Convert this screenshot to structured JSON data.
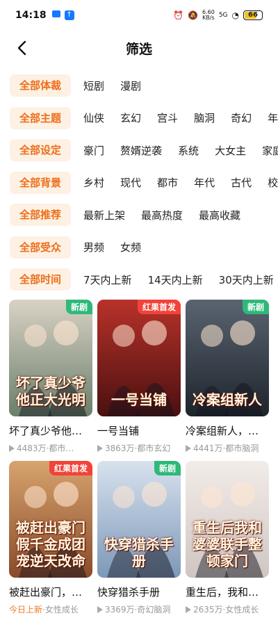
{
  "status": {
    "time": "14:18",
    "net_speed_top": "6.60",
    "net_speed_bottom": "KB/s",
    "signal": "5G",
    "battery": "66"
  },
  "header": {
    "title": "筛选"
  },
  "filters": [
    {
      "selected": "全部体裁",
      "options": [
        "短剧",
        "漫剧"
      ]
    },
    {
      "selected": "全部主题",
      "options": [
        "仙侠",
        "玄幻",
        "宫斗",
        "脑洞",
        "奇幻",
        "年代"
      ]
    },
    {
      "selected": "全部设定",
      "options": [
        "豪门",
        "赘婿逆袭",
        "系统",
        "大女主",
        "家庭"
      ]
    },
    {
      "selected": "全部背景",
      "options": [
        "乡村",
        "现代",
        "都市",
        "年代",
        "古代",
        "校园"
      ]
    },
    {
      "selected": "全部推荐",
      "options": [
        "最新上架",
        "最高热度",
        "最高收藏"
      ]
    },
    {
      "selected": "全部受众",
      "options": [
        "男频",
        "女频"
      ]
    },
    {
      "selected": "全部时间",
      "options": [
        "7天内上新",
        "14天内上新",
        "30天内上新"
      ]
    }
  ],
  "cards": [
    {
      "title": "坏了真少爷他…",
      "poster_text": "坏了真少爷他正大光明",
      "badge": "新剧",
      "badge_color": "#2fb87a",
      "views": "4483万",
      "tags": "都市…",
      "highlight": "",
      "colors": [
        "#6a7f6a",
        "#d9d2c5"
      ]
    },
    {
      "title": "一号当铺",
      "poster_text": "一号当铺",
      "badge": "红果首发",
      "badge_color": "#f1433a",
      "views": "3863万",
      "tags": "都市玄幻",
      "highlight": "",
      "colors": [
        "#4a1010",
        "#b8322a"
      ]
    },
    {
      "title": "冷案组新人，…",
      "poster_text": "冷案组新人",
      "badge": "新剧",
      "badge_color": "#2fb87a",
      "views": "4441万",
      "tags": "都市脑洞",
      "highlight": "",
      "colors": [
        "#1d242c",
        "#5a6470"
      ]
    },
    {
      "title": "被赶出豪门，…",
      "poster_text": "被赶出豪门假千金成团宠逆天改命",
      "badge": "红果首发",
      "badge_color": "#f1433a",
      "views": "",
      "tags": "女性成长",
      "highlight": "今日上新",
      "colors": [
        "#8a4a2a",
        "#d7a46e"
      ]
    },
    {
      "title": "快穿猎杀手册",
      "poster_text": "快穿猎杀手册",
      "badge": "新剧",
      "badge_color": "#2fb87a",
      "views": "3369万",
      "tags": "奇幻脑洞",
      "highlight": "",
      "colors": [
        "#7d98b8",
        "#d8e2ee"
      ]
    },
    {
      "title": "重生后，我和…",
      "poster_text": "重生后我和婆婆联手整顿家门",
      "badge": "",
      "badge_color": "",
      "views": "2635万",
      "tags": "女性成长",
      "highlight": "",
      "colors": [
        "#cfc6c2",
        "#f2ece8"
      ]
    }
  ]
}
